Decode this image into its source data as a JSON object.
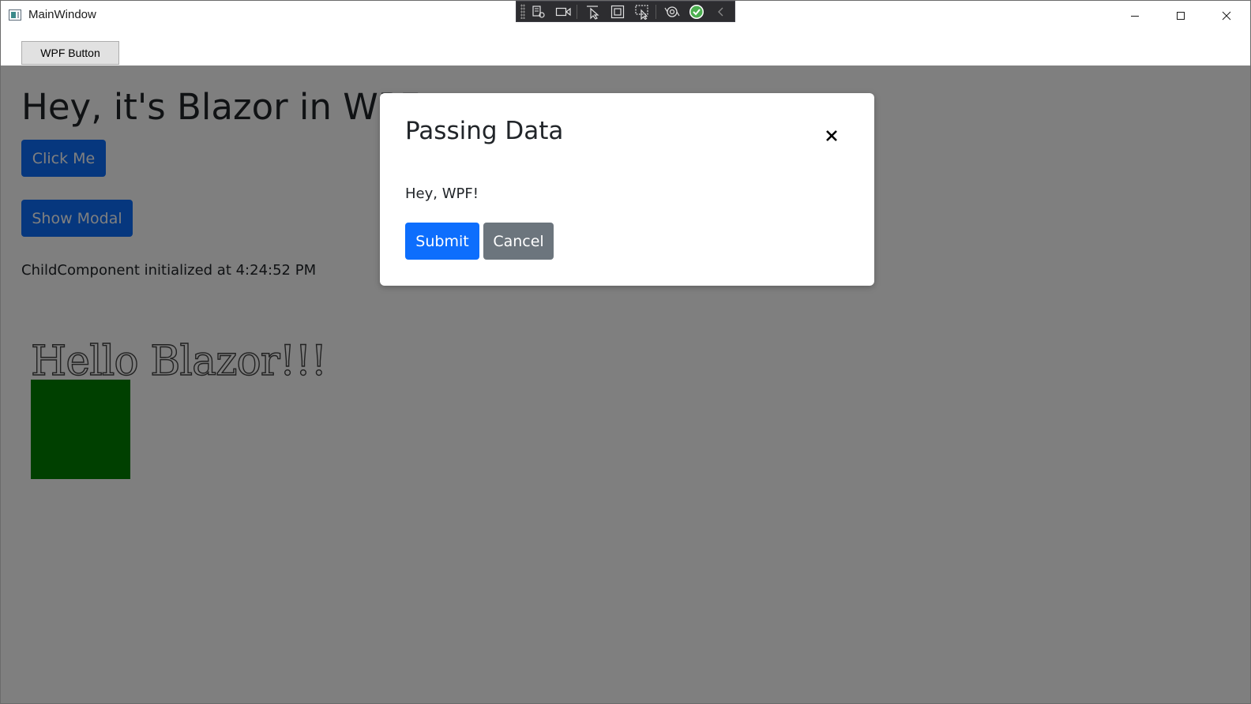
{
  "window": {
    "title": "MainWindow"
  },
  "caption_buttons": {
    "minimize_icon": "minimize-icon",
    "maximize_icon": "maximize-icon",
    "close_icon": "close-icon"
  },
  "debug_toolbar": {
    "icons": [
      "live-visual-tree-icon",
      "video-camera-icon",
      "select-element-icon",
      "display-layout-adorners-icon",
      "track-focus-icon",
      "hot-reload-icon",
      "check-circle-icon",
      "collapse-chevron-icon"
    ],
    "status_color": "#4caf50"
  },
  "wpf": {
    "button_label": "WPF Button"
  },
  "blazor": {
    "heading": "Hey, it's Blazor in WPF!",
    "click_me_label": "Click Me",
    "show_modal_label": "Show Modal",
    "child_component_text": "ChildComponent initialized at 4:24:52 PM",
    "hello_text": "Hello Blazor!!!",
    "square_color": "#008000"
  },
  "modal": {
    "title": "Passing Data",
    "body": "Hey, WPF!",
    "submit_label": "Submit",
    "cancel_label": "Cancel",
    "close_icon": "close-icon"
  },
  "colors": {
    "primary": "#0d6efd",
    "secondary": "#6c757d",
    "backdrop": "rgba(0,0,0,0.5)"
  }
}
